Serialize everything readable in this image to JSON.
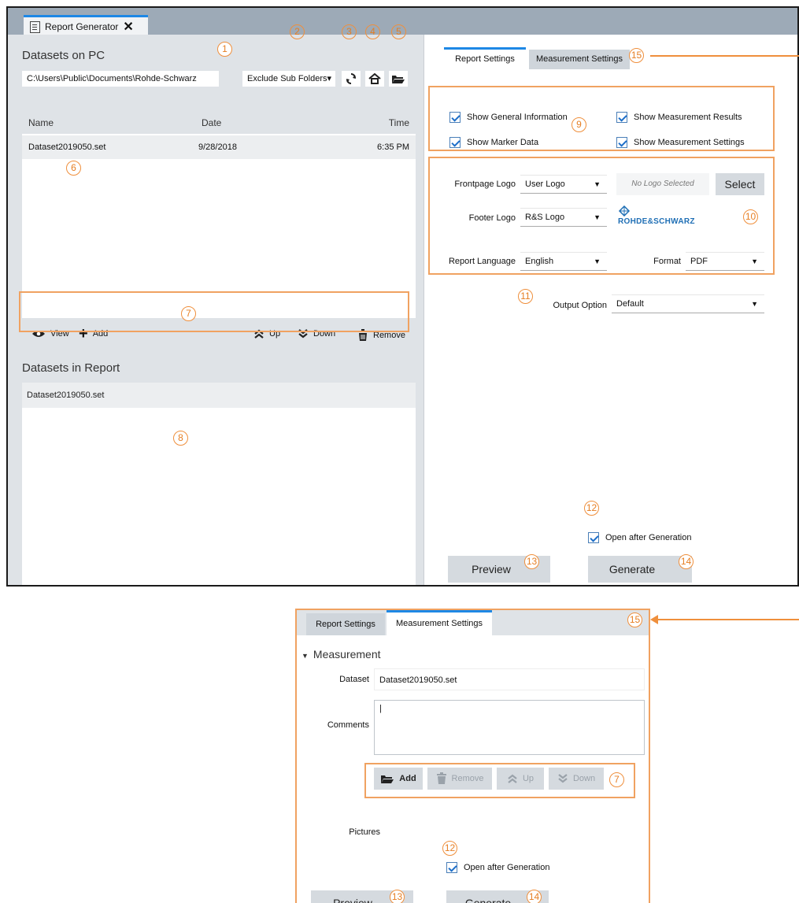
{
  "window": {
    "tab_title": "Report Generator",
    "tab_close": "✕"
  },
  "left": {
    "datasets_pc_title": "Datasets on PC",
    "path": "C:\\Users\\Public\\Documents\\Rohde-Schwarz",
    "subfolders_dropdown": "Exclude Sub Folders▾",
    "table_headers": {
      "name": "Name",
      "date": "Date",
      "time": "Time"
    },
    "rows": [
      {
        "name": "Dataset2019050.set",
        "date": "9/28/2018",
        "time": "6:35 PM"
      }
    ],
    "toolbar": {
      "view": "View",
      "add": "Add",
      "up": "Up",
      "down": "Down",
      "remove": "Remove"
    },
    "datasets_report_title": "Datasets in Report",
    "report_rows": [
      "Dataset2019050.set"
    ]
  },
  "right": {
    "tabs": {
      "report_settings": "Report Settings",
      "measurement_settings": "Measurement Settings"
    },
    "checkboxes": {
      "general_info": "Show General Information",
      "measurement_results": "Show Measurement Results",
      "marker_data": "Show Marker Data",
      "measurement_settings": "Show Measurement Settings"
    },
    "frontpage_logo_label": "Frontpage Logo",
    "frontpage_logo_value": "User Logo",
    "no_logo": "No Logo Selected",
    "select_button": "Select",
    "footer_logo_label": "Footer Logo",
    "footer_logo_value": "R&S Logo",
    "rs_logo_text": "ROHDE&SCHWARZ",
    "report_language_label": "Report Language",
    "report_language_value": "English",
    "format_label": "Format",
    "format_value": "PDF",
    "output_option_label": "Output Option",
    "output_option_value": "Default",
    "open_after": "Open after Generation",
    "preview": "Preview",
    "generate": "Generate"
  },
  "panel2": {
    "tabs": {
      "report_settings": "Report Settings",
      "measurement_settings": "Measurement Settings"
    },
    "measurement_header": "Measurement",
    "dataset_label": "Dataset",
    "dataset_value": "Dataset2019050.set",
    "comments_label": "Comments",
    "comments_value": "|",
    "buttons": {
      "add": "Add",
      "remove": "Remove",
      "up": "Up",
      "down": "Down"
    },
    "pictures_label": "Pictures",
    "open_after": "Open after Generation",
    "preview": "Preview",
    "generate": "Generate"
  },
  "callouts": [
    "1",
    "2",
    "3",
    "4",
    "5",
    "6",
    "7",
    "8",
    "9",
    "10",
    "11",
    "12",
    "13",
    "14",
    "15"
  ],
  "colors": {
    "accent_blue": "#1e88e5",
    "callout_orange": "#ef8f3c",
    "rs_blue": "#1f6fb5"
  }
}
